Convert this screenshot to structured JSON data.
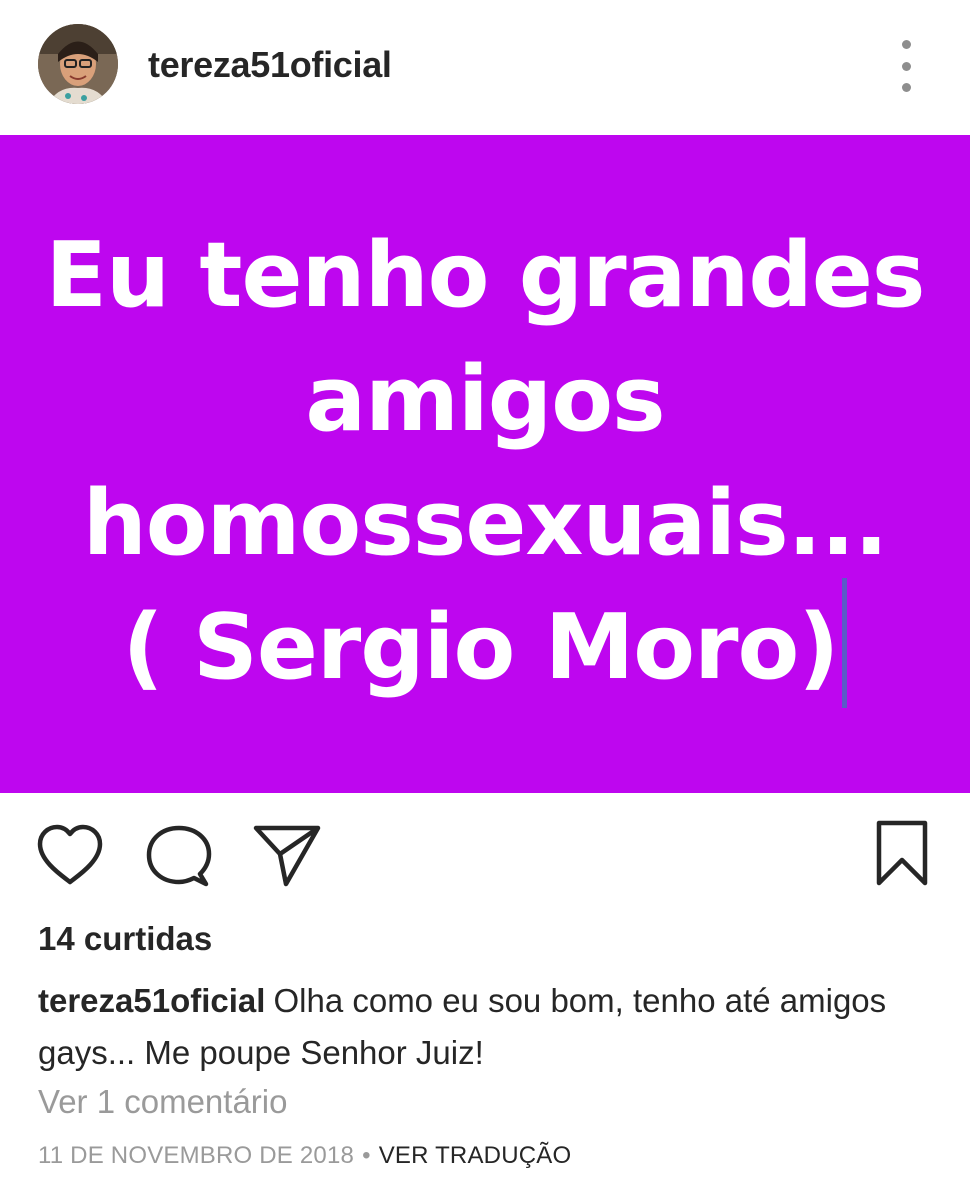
{
  "post": {
    "username": "tereza51oficial",
    "image_text": {
      "line1": "Eu tenho grandes",
      "line2": "amigos",
      "line3": "homossexuais...",
      "line4": "( Sergio Moro)"
    },
    "likes": "14 curtidas",
    "caption_user": "tereza51oficial",
    "caption_text": "Olha como eu sou bom, tenho até amigos gays... Me poupe Senhor Juiz!",
    "view_comments": "Ver 1 comentário",
    "date": "11 DE NOVEMBRO DE 2018",
    "separator": "•",
    "translate": "VER TRADUÇÃO"
  },
  "colors": {
    "image_background": "#be06ef",
    "text_primary": "#262626",
    "text_secondary": "#9a9a9a"
  },
  "icons": {
    "like": "heart-icon",
    "comment": "comment-icon",
    "share": "paper-plane-icon",
    "save": "bookmark-icon",
    "more": "more-vertical-icon"
  }
}
